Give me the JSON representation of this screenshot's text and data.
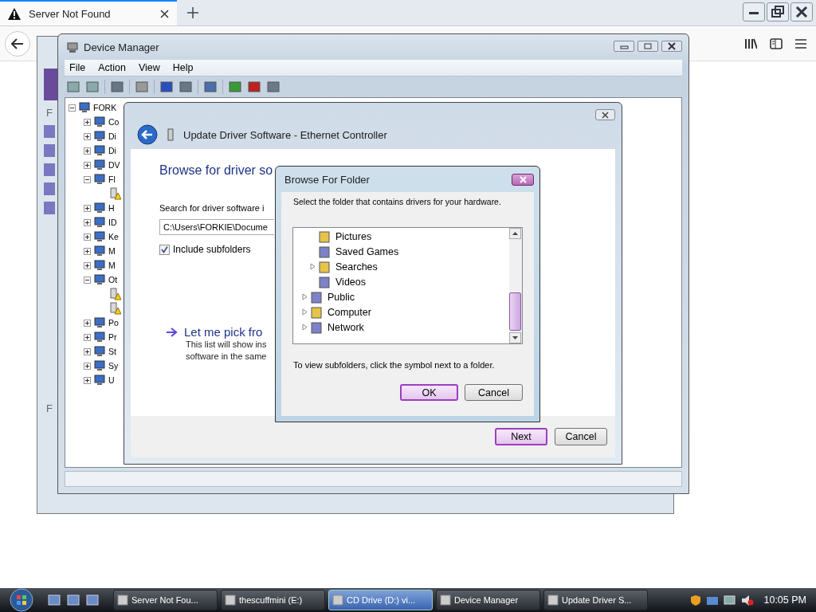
{
  "browser": {
    "tabs": [
      {
        "title": "Server Not Found",
        "selected": true
      }
    ]
  },
  "behind_window": {
    "labels": [
      "F",
      "F"
    ]
  },
  "device_manager": {
    "title": "Device Manager",
    "menu": [
      "File",
      "Action",
      "View",
      "Help"
    ],
    "tree": [
      {
        "label": "FORK",
        "expanded": true,
        "warning": false,
        "children": [
          {
            "label": "Co",
            "expanded": false,
            "warning": false
          },
          {
            "label": "Di",
            "expanded": false,
            "warning": false
          },
          {
            "label": "Di",
            "expanded": false,
            "warning": false
          },
          {
            "label": "DV",
            "expanded": false,
            "warning": false
          },
          {
            "label": "Fl",
            "expanded": true,
            "warning": false,
            "children": [
              {
                "warning": true
              }
            ]
          },
          {
            "label": "H",
            "expanded": false,
            "warning": false
          },
          {
            "label": "ID",
            "expanded": false,
            "warning": false
          },
          {
            "label": "Ke",
            "expanded": false,
            "warning": false
          },
          {
            "label": "M",
            "expanded": false,
            "warning": false
          },
          {
            "label": "M",
            "expanded": false,
            "warning": false
          },
          {
            "label": "Ot",
            "expanded": true,
            "warning": false,
            "children": [
              {
                "warning": true
              },
              {
                "warning": true
              }
            ]
          },
          {
            "label": "Po",
            "expanded": false,
            "warning": false
          },
          {
            "label": "Pr",
            "expanded": false,
            "warning": false
          },
          {
            "label": "St",
            "expanded": false,
            "warning": false
          },
          {
            "label": "Sy",
            "expanded": false,
            "warning": false
          },
          {
            "label": "U",
            "expanded": false,
            "warning": false
          }
        ]
      }
    ]
  },
  "update_driver": {
    "title": "Update Driver Software - Ethernet Controller",
    "heading": "Browse for driver so",
    "search_label": "Search for driver software i",
    "path": "C:\\Users\\FORKIE\\Docume",
    "include_subfolders": {
      "label": "Include subfolders",
      "checked": true
    },
    "pick_link": "Let me pick fro",
    "pick_description": [
      "This list will show ins",
      "software in the same"
    ],
    "buttons": [
      {
        "label": "Next",
        "default": true
      },
      {
        "label": "Cancel",
        "default": false
      }
    ]
  },
  "browse_for_folder": {
    "title": "Browse For Folder",
    "instruction": "Select the folder that contains drivers for your hardware.",
    "tree": [
      {
        "children": [
          {
            "label": "Pictures",
            "expandable": false
          },
          {
            "label": "Saved Games",
            "expandable": false
          },
          {
            "label": "Searches",
            "expandable": true
          },
          {
            "label": "Videos",
            "expandable": false
          }
        ]
      },
      {
        "label": "Public",
        "expandable": true
      },
      {
        "label": "Computer",
        "expandable": true
      },
      {
        "label": "Network",
        "expandable": true
      }
    ],
    "hint": "To view subfolders, click the symbol next to a folder.",
    "buttons": [
      {
        "label": "OK",
        "default": true
      },
      {
        "label": "Cancel",
        "default": false
      }
    ]
  },
  "taskbar": {
    "tasks": [
      {
        "label": "Server Not Fou...",
        "selected": false
      },
      {
        "label": "thescuffmini (E:)",
        "selected": false
      },
      {
        "label": "CD Drive (D:) vi...",
        "selected": true
      },
      {
        "label": "Device Manager",
        "selected": false
      },
      {
        "label": "Update Driver S...",
        "selected": false
      }
    ],
    "clock": "10:05 PM"
  }
}
